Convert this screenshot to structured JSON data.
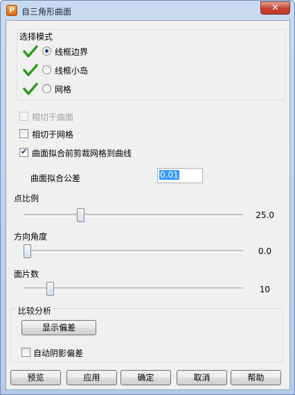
{
  "window": {
    "title": "自三角形曲面",
    "icon_letter": "P",
    "close_symbol": "✕"
  },
  "mode_group": {
    "title": "选择模式",
    "options": [
      {
        "label": "线框边界",
        "selected": true
      },
      {
        "label": "线框小岛",
        "selected": false
      },
      {
        "label": "网格",
        "selected": false
      }
    ]
  },
  "checkboxes": {
    "tangent_surface": {
      "label": "相切于曲面",
      "checked": false,
      "enabled": false
    },
    "tangent_mesh": {
      "label": "相切于网格",
      "checked": false,
      "enabled": true
    },
    "trim_mesh": {
      "label": "曲面拟合前剪裁网格到曲线",
      "checked": true,
      "enabled": true
    }
  },
  "tolerance": {
    "label": "曲面拟合公差",
    "value": "0.01"
  },
  "sliders": {
    "point_ratio": {
      "label": "点比例",
      "value": "25.0"
    },
    "direction_angle": {
      "label": "方向角度",
      "value": "0.0"
    },
    "patch_count": {
      "label": "面片数",
      "value": "10"
    }
  },
  "compare_group": {
    "title": "比较分析",
    "show_deviation_label": "显示偏差",
    "auto_shade_label": "自动阴影偏差"
  },
  "buttons": {
    "preview": "预览",
    "apply": "应用",
    "ok": "确定",
    "cancel": "取消",
    "help": "帮助"
  }
}
